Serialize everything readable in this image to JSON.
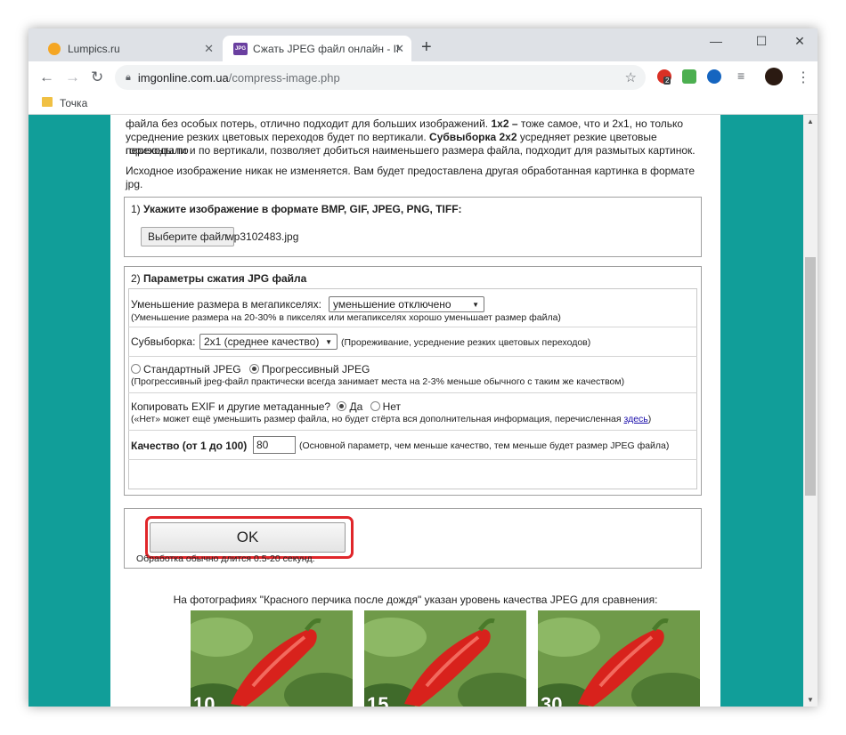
{
  "tabs": [
    {
      "title": "Lumpics.ru"
    },
    {
      "title": "Сжать JPEG файл онлайн - IMG"
    }
  ],
  "new_tab_label": "+",
  "window_controls": {
    "minimize": "—",
    "maximize": "☐",
    "close": "✕"
  },
  "address_bar": {
    "host": "imgonline.com.ua",
    "path": "/compress-image.php"
  },
  "extensions": {
    "badge": "2"
  },
  "bookmarks": [
    {
      "label": "Точка"
    }
  ],
  "intro": {
    "line1_pre": "файла без особых потерь, отлично подходит для больших изображений. ",
    "line1_bold": "1x2 –",
    "line1_post": " тоже самое, что и 2x1, но только",
    "line2_pre": "усреднение резких цветовых переходов будет по вертикали. ",
    "line2_bold": "Субвыборка 2x2",
    "line2_post": " усредняет резкие цветовые переходы по",
    "line3": "горизонтали и по вертикали, позволяет добиться наименьшего размера файла, подходит для размытых картинок.",
    "line4": "Исходное изображение никак не изменяется. Вам будет предоставлена другая обработанная картинка в формате jpg."
  },
  "step1": {
    "prefix": "1) ",
    "title": "Укажите изображение в формате BMP, GIF, JPEG, PNG, TIFF:",
    "file_button": "Выберите файл",
    "file_name": "wp3102483.jpg"
  },
  "step2": {
    "prefix": "2) ",
    "title": "Параметры сжатия JPG файла",
    "resize_label": "Уменьшение размера в мегапикселях:",
    "resize_value": "уменьшение отключено",
    "resize_hint": "(Уменьшение размера на 20-30% в пикселях или мегапикселях хорошо уменьшает размер файла)",
    "subsampling_label": "Субвыборка:",
    "subsampling_value": "2x1 (среднее качество)",
    "subsampling_hint": "(Прореживание, усреднение резких цветовых переходов)",
    "standard_jpeg": "Стандартный JPEG",
    "progressive_jpeg": "Прогрессивный JPEG",
    "progressive_hint": "(Прогрессивный jpeg-файл практически всегда занимает места на 2-3% меньше обычного с таким же качеством)",
    "exif_label": "Копировать EXIF и другие метаданные?",
    "exif_yes": "Да",
    "exif_no": "Нет",
    "exif_hint_pre": "(«Нет» может ещё уменьшить размер файла, но будет стёрта вся дополнительная информация, перечисленная ",
    "exif_hint_link": "здесь",
    "exif_hint_post": ")",
    "quality_label": "Качество (от 1 до 100)",
    "quality_value": "80",
    "quality_hint": "(Основной параметр, чем меньше качество, тем меньше будет размер JPEG файла)"
  },
  "step3": {
    "ok_button": "OK",
    "processing_note": "Обработка обычно длится 0.5-20 секунд."
  },
  "comparison": {
    "caption": "На фотографиях \"Красного перчика после дождя\" указан уровень качества JPEG для сравнения:",
    "samples": [
      {
        "quality": "10"
      },
      {
        "quality": "15"
      },
      {
        "quality": "30"
      }
    ]
  },
  "colors": {
    "page_background": "#119e99",
    "highlight": "#e0262a"
  }
}
